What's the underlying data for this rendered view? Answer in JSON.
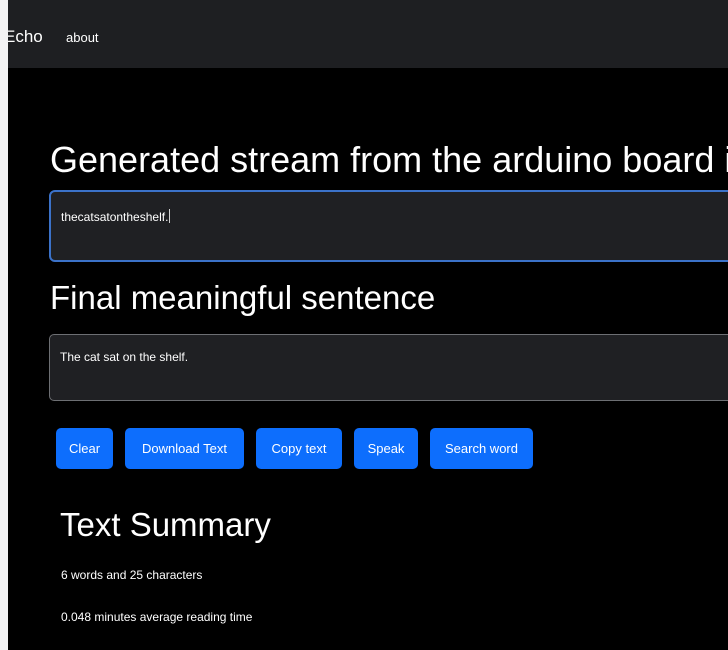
{
  "navbar": {
    "brand": "Echo",
    "links": [
      "about"
    ]
  },
  "stream": {
    "heading": "Generated stream from the arduino board is",
    "value": "thecatsatontheshelf."
  },
  "final": {
    "heading": "Final meaningful sentence",
    "value": "The cat sat on the shelf."
  },
  "actions": {
    "clear": "Clear",
    "download": "Download Text",
    "copy": "Copy text",
    "speak": "Speak",
    "search": "Search word"
  },
  "summary": {
    "heading": "Text Summary",
    "counts": "6 words and 25 characters",
    "reading_time": "0.048 minutes average reading time"
  },
  "colors": {
    "background": "#000000",
    "navbar": "#1e1f22",
    "button": "#0d6efd",
    "focus_border": "#3b72c9"
  }
}
